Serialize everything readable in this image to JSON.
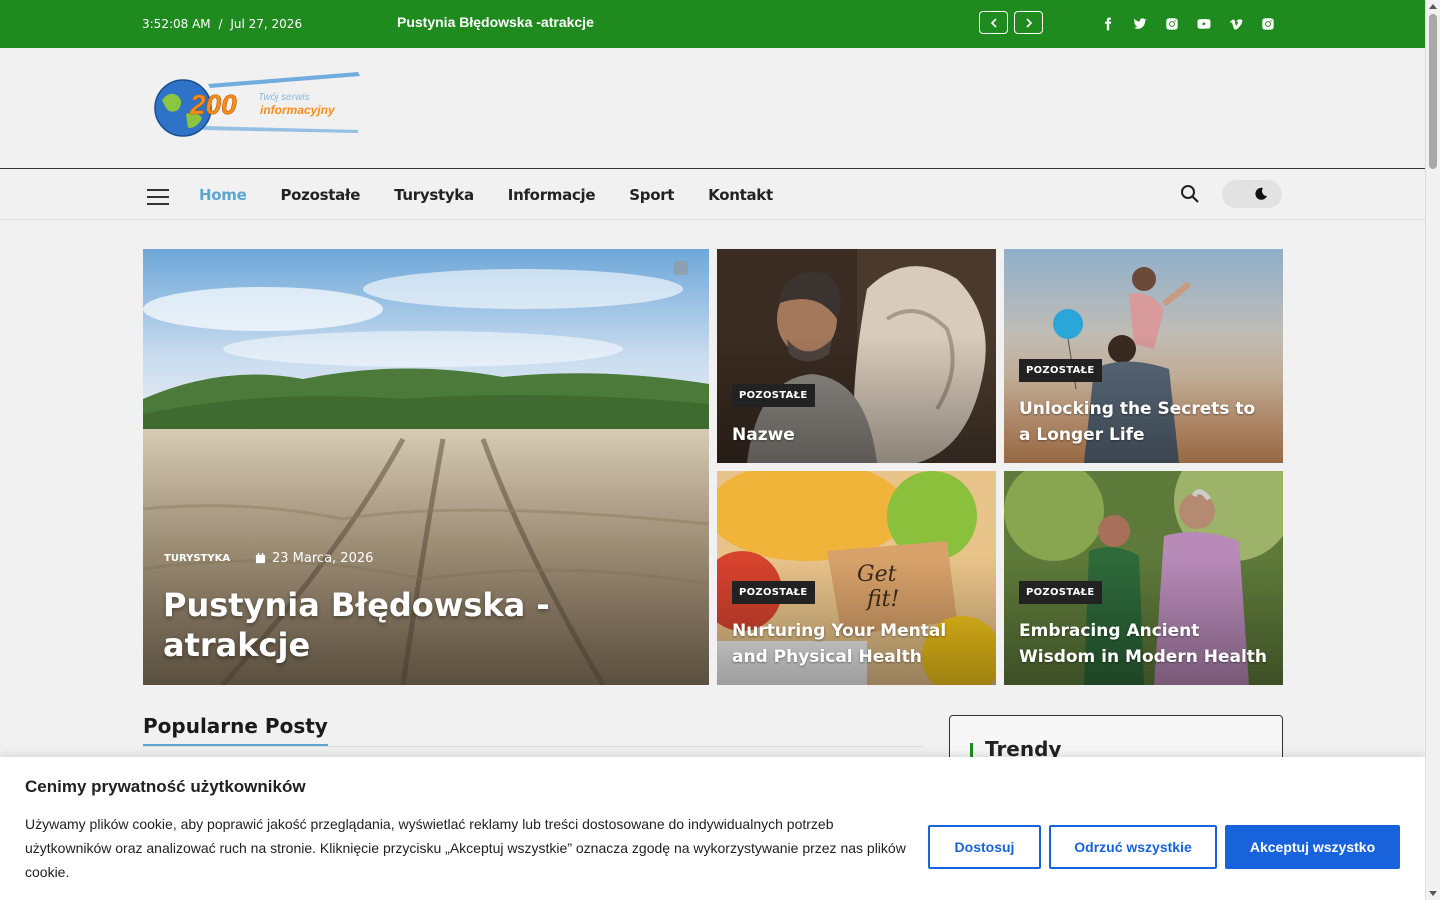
{
  "topbar": {
    "time": "3:52:08 AM",
    "sep": "/",
    "date": "Jul 27, 2026",
    "ticker": "Pustynia Błędowska -atrakcje",
    "socials": [
      "facebook-icon",
      "twitter-icon",
      "instagram-icon",
      "youtube-icon",
      "vimeo-icon",
      "instagram-icon"
    ]
  },
  "logo": {
    "number": "200",
    "line1": "Twój serwis",
    "line2": "informacyjny"
  },
  "nav": {
    "items": [
      "Home",
      "Pozostałe",
      "Turystyka",
      "Informacje",
      "Sport",
      "Kontakt"
    ],
    "active": "Home"
  },
  "hero": {
    "main": {
      "category": "TURYSTYKA",
      "date": "23 Marca, 2026",
      "title": "Pustynia Błędowska -atrakcje"
    },
    "cards": [
      {
        "category": "POZOSTAŁE",
        "title": "Nazwe"
      },
      {
        "category": "POZOSTAŁE",
        "title": "Unlocking the Secrets to a Longer Life"
      },
      {
        "category": "POZOSTAŁE",
        "title": "Nurturing Your Mental and Physical Health"
      },
      {
        "category": "POZOSTAŁE",
        "title": "Embracing Ancient Wisdom in Modern Health"
      }
    ]
  },
  "sections": {
    "popular": "Popularne Posty",
    "trendy": "Trendy"
  },
  "cookie": {
    "title": "Cenimy prywatność użytkowników",
    "text": "Używamy plików cookie, aby poprawić jakość przeglądania, wyświetlać reklamy lub treści dostosowane do indywidualnych potrzeb użytkowników oraz analizować ruch na stronie. Kliknięcie przycisku „Akceptuj wszystkie” oznacza zgodę na wykorzystywanie przez nas plików cookie.",
    "customize": "Dostosuj",
    "reject": "Odrzuć wszystkie",
    "accept": "Akceptuj wszystko"
  },
  "colors": {
    "topbar": "#1f8b1f",
    "accent": "#5aa6cf",
    "cookie_button": "#1863dc"
  }
}
